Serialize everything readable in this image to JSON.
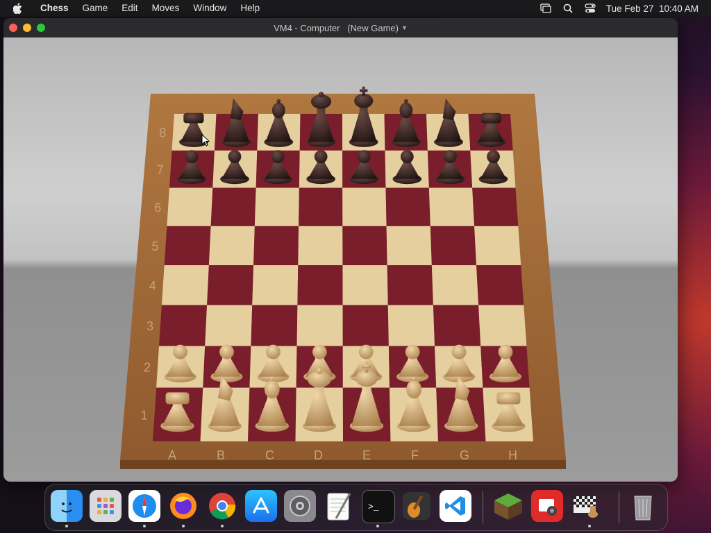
{
  "menubar": {
    "app_name": "Chess",
    "items": [
      "Game",
      "Edit",
      "Moves",
      "Window",
      "Help"
    ],
    "date_time": "Tue Feb 27  10:40 AM"
  },
  "window": {
    "title": "VM4 - Computer   (New Game)"
  },
  "board": {
    "rank_labels": [
      "8",
      "7",
      "6",
      "5",
      "4",
      "3",
      "2",
      "1"
    ],
    "file_labels": [
      "A",
      "B",
      "C",
      "D",
      "E",
      "F",
      "G",
      "H"
    ],
    "light_square_color": "#e6cf9f",
    "dark_square_color": "#7b1e2b",
    "frame_color": "#a86c39",
    "black_pieces": [
      "rook",
      "knight",
      "bishop",
      "queen",
      "king",
      "bishop",
      "knight",
      "rook"
    ],
    "white_pieces": [
      "rook",
      "knight",
      "bishop",
      "queen",
      "king",
      "bishop",
      "knight",
      "rook"
    ]
  },
  "dock": {
    "apps": [
      {
        "name": "finder-icon",
        "running": true
      },
      {
        "name": "launchpad-icon",
        "running": false
      },
      {
        "name": "safari-icon",
        "running": true
      },
      {
        "name": "firefox-icon",
        "running": true
      },
      {
        "name": "chrome-icon",
        "running": true
      },
      {
        "name": "app-store-icon",
        "running": false
      },
      {
        "name": "system-settings-icon",
        "running": false
      },
      {
        "name": "textedit-icon",
        "running": false
      },
      {
        "name": "terminal-icon",
        "running": true
      },
      {
        "name": "garageband-icon",
        "running": false
      },
      {
        "name": "vscode-icon",
        "running": false
      },
      {
        "name": "minecraft-icon",
        "running": false
      },
      {
        "name": "photo-booth-icon",
        "running": false
      },
      {
        "name": "chess-icon",
        "running": true
      },
      {
        "name": "trash-icon",
        "running": false
      }
    ]
  }
}
